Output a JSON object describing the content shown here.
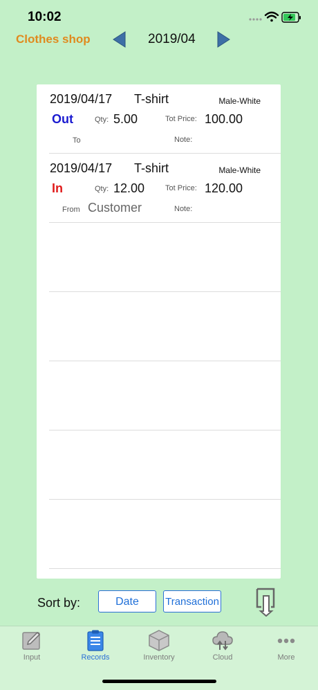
{
  "status": {
    "time": "10:02"
  },
  "header": {
    "shop_name": "Clothes shop",
    "period": "2019/04"
  },
  "colors": {
    "background": "#c3f0c8",
    "accent": "#2a6fd6",
    "shop": "#e08a1e",
    "out": "#1a1ad0",
    "in": "#e01b1b"
  },
  "records": [
    {
      "date": "2019/04/17",
      "item": "T-shirt",
      "variant": "Male-White",
      "type": "Out",
      "qty_label": "Qty:",
      "qty": "5.00",
      "tot_label": "Tot Price:",
      "tot": "100.00",
      "party_label": "To",
      "party": "",
      "note_label": "Note:"
    },
    {
      "date": "2019/04/17",
      "item": "T-shirt",
      "variant": "Male-White",
      "type": "In",
      "qty_label": "Qty:",
      "qty": "12.00",
      "tot_label": "Tot Price:",
      "tot": "120.00",
      "party_label": "From",
      "party": "Customer",
      "note_label": "Note:"
    }
  ],
  "sort": {
    "label": "Sort by:",
    "date": "Date",
    "transaction": "Transaction"
  },
  "tabs": [
    {
      "label": "Input",
      "icon": "edit-icon"
    },
    {
      "label": "Records",
      "icon": "clipboard-icon"
    },
    {
      "label": "Inventory",
      "icon": "box-icon"
    },
    {
      "label": "Cloud",
      "icon": "cloud-icon"
    },
    {
      "label": "More",
      "icon": "more-icon"
    }
  ]
}
